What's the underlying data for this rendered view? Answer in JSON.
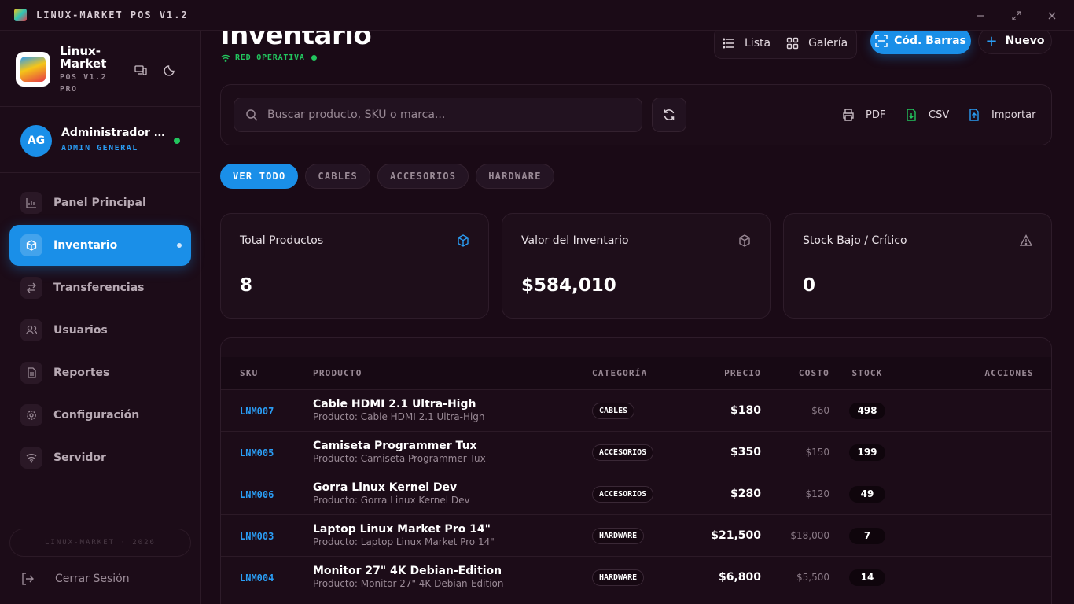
{
  "window": {
    "title": "LINUX-MARKET POS V1.2"
  },
  "sidebar": {
    "brand_name": "Linux-Market",
    "brand_version": "POS V1.2 PRO",
    "logo_text": "Linux Market",
    "user": {
      "initials": "AG",
      "name": "Administrador General",
      "role": "ADMIN GENERAL",
      "online_color": "#22c55e"
    },
    "items": [
      {
        "label": "Panel Principal",
        "icon": "chart-icon"
      },
      {
        "label": "Inventario",
        "icon": "box-icon",
        "active": true
      },
      {
        "label": "Transferencias",
        "icon": "arrows-icon"
      },
      {
        "label": "Usuarios",
        "icon": "users-icon"
      },
      {
        "label": "Reportes",
        "icon": "document-icon"
      },
      {
        "label": "Configuración",
        "icon": "gear-icon"
      },
      {
        "label": "Servidor",
        "icon": "wifi-icon"
      }
    ],
    "copyright": "LINUX-MARKET · 2026",
    "logout_label": "Cerrar Sesión"
  },
  "header": {
    "title": "Inventario",
    "network_status": "RED OPERATIVA",
    "view_list_label": "Lista",
    "view_gallery_label": "Galería",
    "barcode_label": "Cód. Barras",
    "new_label": "Nuevo"
  },
  "toolbar": {
    "search_placeholder": "Buscar producto, SKU o marca...",
    "search_value": "",
    "pdf_label": "PDF",
    "csv_label": "CSV",
    "import_label": "Importar"
  },
  "filters": [
    "VER TODO",
    "CABLES",
    "ACCESORIOS",
    "HARDWARE"
  ],
  "stats": [
    {
      "label": "Total Productos",
      "value": "8",
      "icon": "box-icon"
    },
    {
      "label": "Valor del Inventario",
      "value": "$584,010",
      "icon": "box-icon"
    },
    {
      "label": "Stock Bajo / Crítico",
      "value": "0",
      "icon": "warning-icon"
    }
  ],
  "table": {
    "headers": {
      "sku": "SKU",
      "product": "PRODUCTO",
      "category": "CATEGORÍA",
      "price": "PRECIO",
      "cost": "COSTO",
      "stock": "STOCK",
      "actions": "ACCIONES"
    },
    "rows": [
      {
        "sku": "LNM007",
        "name": "Cable HDMI 2.1 Ultra-High",
        "sub": "Producto: Cable HDMI 2.1 Ultra-High",
        "category": "CABLES",
        "price": "$180",
        "cost": "$60",
        "stock": "498"
      },
      {
        "sku": "LNM005",
        "name": "Camiseta Programmer Tux",
        "sub": "Producto: Camiseta Programmer Tux",
        "category": "ACCESORIOS",
        "price": "$350",
        "cost": "$150",
        "stock": "199"
      },
      {
        "sku": "LNM006",
        "name": "Gorra Linux Kernel Dev",
        "sub": "Producto: Gorra Linux Kernel Dev",
        "category": "ACCESORIOS",
        "price": "$280",
        "cost": "$120",
        "stock": "49"
      },
      {
        "sku": "LNM003",
        "name": "Laptop Linux Market Pro 14\"",
        "sub": "Producto: Laptop Linux Market Pro 14\"",
        "category": "HARDWARE",
        "price": "$21,500",
        "cost": "$18,000",
        "stock": "7"
      },
      {
        "sku": "LNM004",
        "name": "Monitor 27\" 4K Debian-Edition",
        "sub": "Producto: Monitor 27\" 4K Debian-Edition",
        "category": "HARDWARE",
        "price": "$6,800",
        "cost": "$5,500",
        "stock": "14"
      }
    ]
  },
  "colors": {
    "accent": "#1a8fe8",
    "background": "#1a0a16",
    "success": "#22c55e"
  }
}
